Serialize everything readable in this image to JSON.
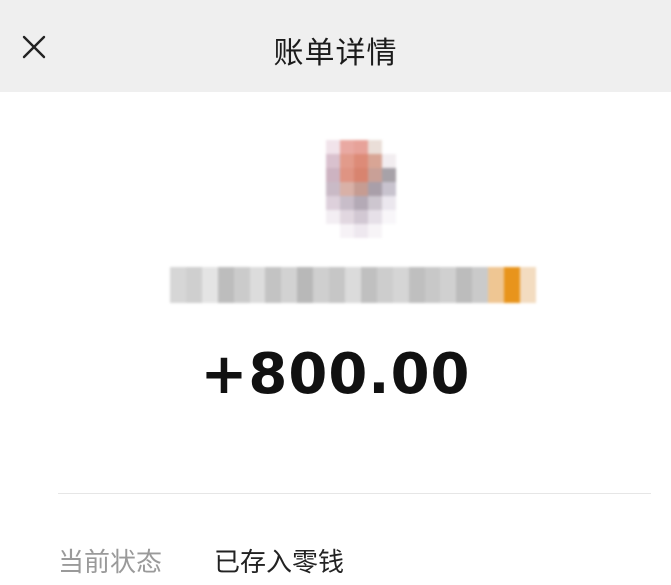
{
  "header": {
    "close_icon": "close-icon",
    "title": "账单详情"
  },
  "transaction": {
    "amount": "+800.00",
    "status_label": "当前状态",
    "status_value": "已存入零钱"
  },
  "colors": {
    "header_bg": "#efefef",
    "mosaic_accent": "#e8941c"
  }
}
